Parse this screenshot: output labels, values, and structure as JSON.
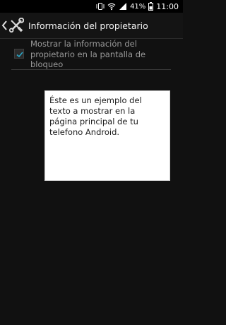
{
  "status_bar": {
    "battery_percent": "41%",
    "time": "11:00",
    "icons": [
      "vibrate-icon",
      "wifi-icon",
      "signal-icon",
      "battery-icon"
    ]
  },
  "action_bar": {
    "title": "Información del propietario",
    "icons": [
      "back-chevron-icon",
      "wrench-screwdriver-icon"
    ]
  },
  "option": {
    "label": "Mostrar la información del propietario en la pantalla de bloqueo",
    "checked": true
  },
  "owner_info": {
    "text": "Éste es un ejemplo del texto a mostrar en la página principal de tu telefono Android."
  },
  "colors": {
    "background": "#111111",
    "status_bar": "#000000",
    "check_accent": "#2aa8c9"
  }
}
